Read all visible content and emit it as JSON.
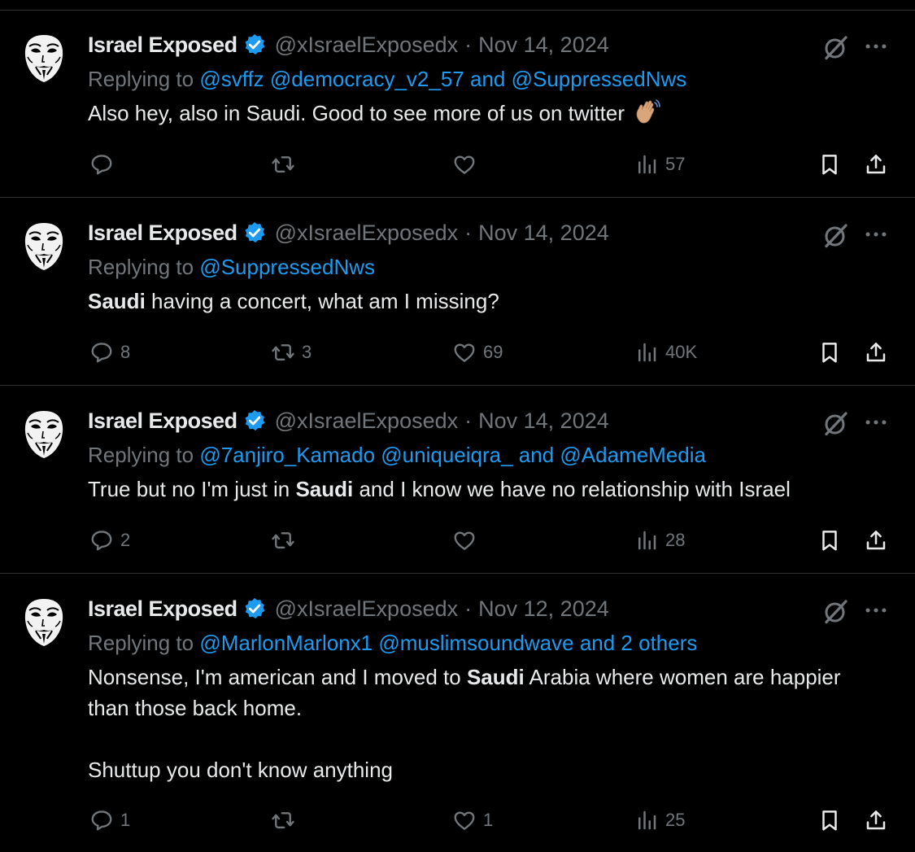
{
  "tweets": [
    {
      "author": "Israel Exposed",
      "handle": "@xIsraelExposedx",
      "separator": "·",
      "date": "Nov 14, 2024",
      "replying_prefix": "Replying to",
      "replying_to": "@svffz @democracy_v2_57 and @SuppressedNws",
      "text_plain": "Also hey, also in Saudi. Good to see more of us on twitter",
      "has_emoji": true,
      "emoji": "waving-hand-emoji",
      "counts": {
        "replies": "",
        "reposts": "",
        "likes": "",
        "views": "57"
      }
    },
    {
      "author": "Israel Exposed",
      "handle": "@xIsraelExposedx",
      "separator": "·",
      "date": "Nov 14, 2024",
      "replying_prefix": "Replying to",
      "replying_to": "@SuppressedNws",
      "text_bold": "Saudi",
      "text_after": " having a concert, what am I missing?",
      "counts": {
        "replies": "8",
        "reposts": "3",
        "likes": "69",
        "views": "40K"
      }
    },
    {
      "author": "Israel Exposed",
      "handle": "@xIsraelExposedx",
      "separator": "·",
      "date": "Nov 14, 2024",
      "replying_prefix": "Replying to",
      "replying_to": "@7anjiro_Kamado @uniqueiqra_ and @AdameMedia",
      "text_before": "True but no I'm just in ",
      "text_bold": "Saudi",
      "text_after": " and I know we have no relationship with Israel",
      "counts": {
        "replies": "2",
        "reposts": "",
        "likes": "",
        "views": "28"
      }
    },
    {
      "author": "Israel Exposed",
      "handle": "@xIsraelExposedx",
      "separator": "·",
      "date": "Nov 12, 2024",
      "replying_prefix": "Replying to",
      "replying_to": "@MarlonMarlonx1 @muslimsoundwave and 2 others",
      "text_before": "Nonsense, I'm american and I moved to ",
      "text_bold": "Saudi",
      "text_after": " Arabia where women are happier than those back home.",
      "text_para2": "Shuttup you don't know anything",
      "counts": {
        "replies": "1",
        "reposts": "",
        "likes": "1",
        "views": "25"
      }
    }
  ],
  "colors": {
    "background": "#000000",
    "text": "#e7e9ea",
    "muted": "#71767b",
    "accent": "#1d9bf0",
    "divider": "#2f3336"
  },
  "icons": {
    "avatar": "guy-fawkes-mask-icon",
    "verified": "verified-badge-icon",
    "grok": "grok-icon",
    "more": "more-icon",
    "reply": "reply-icon",
    "repost": "repost-icon",
    "like": "heart-icon",
    "views": "views-icon",
    "bookmark": "bookmark-icon",
    "share": "share-icon"
  }
}
